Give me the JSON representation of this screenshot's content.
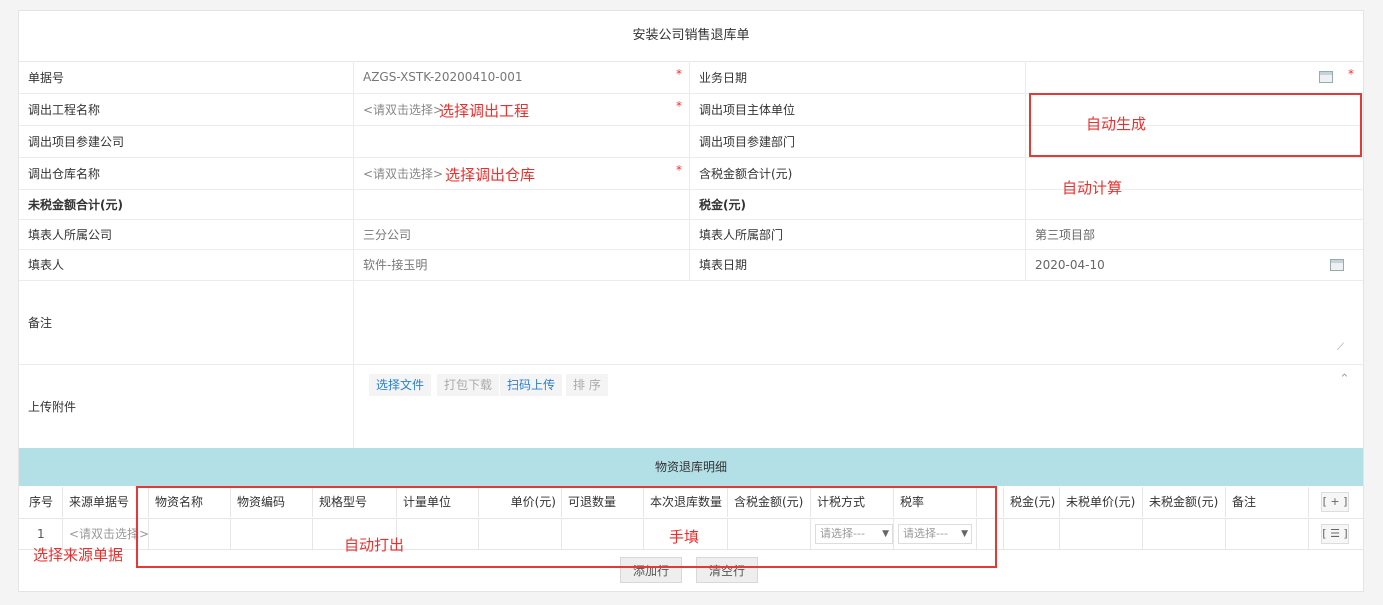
{
  "form_title": "安装公司销售退库单",
  "fields": {
    "doc_no_label": "单据号",
    "doc_no_value": "AZGS-XSTK-20200410-001",
    "biz_date_label": "业务日期",
    "out_project_label": "调出工程名称",
    "out_project_placeholder": "<请双击选择>",
    "out_main_unit_label": "调出项目主体单位",
    "out_company_label": "调出项目参建公司",
    "out_dept_label": "调出项目参建部门",
    "out_warehouse_label": "调出仓库名称",
    "out_warehouse_placeholder": "<请双击选择>",
    "tax_total_label": "含税金额合计(元)",
    "notax_total_label": "未税金额合计(元)",
    "tax_label": "税金(元)",
    "filler_company_label": "填表人所属公司",
    "filler_company_value": "三分公司",
    "filler_dept_label": "填表人所属部门",
    "filler_dept_value": "第三项目部",
    "filler_label": "填表人",
    "filler_value": "软件-接玉明",
    "fill_date_label": "填表日期",
    "fill_date_value": "2020-04-10",
    "remark_label": "备注",
    "attach_label": "上传附件"
  },
  "attach_buttons": {
    "choose": "选择文件",
    "pack": "打包下载",
    "scan": "扫码上传",
    "sort": "排 序"
  },
  "required_mark": "*",
  "annotations": {
    "choose_project": "选择调出工程",
    "choose_warehouse": "选择调出仓库",
    "auto_generate": "自动生成",
    "auto_calc": "自动计算",
    "auto_fill": "自动打出",
    "manual": "手填",
    "choose_source": "选择来源单据"
  },
  "detail": {
    "title": "物资退库明细",
    "columns": [
      "序号",
      "来源单据号",
      "物资名称",
      "物资编码",
      "规格型号",
      "计量单位",
      "单价(元)",
      "可退数量",
      "本次退库数量",
      "含税金额(元)",
      "计税方式",
      "税率",
      "",
      "税金(元)",
      "未税单价(元)",
      "未税金额(元)",
      "备注"
    ],
    "add_col_btn": "[ + ]",
    "row": {
      "index": "1",
      "source": "<请双击选择>",
      "tax_method": "请选择---",
      "tax_rate": "请选择---",
      "row_btn": "[ ☰ ]"
    },
    "add_row": "添加行",
    "clear_row": "清空行"
  },
  "colors": {
    "accent": "#b3e0e6",
    "annotation": "#e8312f",
    "link": "#2a7fd4"
  }
}
